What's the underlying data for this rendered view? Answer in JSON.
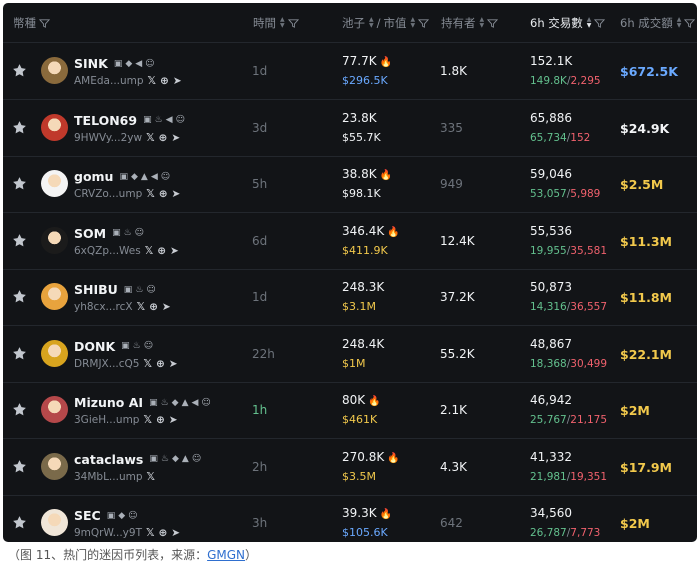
{
  "header": {
    "token": "幣種",
    "time": "時間",
    "pool": "池子",
    "mcap": "市值",
    "holders": "持有者",
    "txs": "6h 交易數",
    "volume": "6h 成交額"
  },
  "colors": {
    "blue": "#6aa9ff",
    "yellow": "#f2c94c",
    "white": "#f2f4f6",
    "green": "#63c08e",
    "red": "#f0616d",
    "dim": "#6d737b"
  },
  "rows": [
    {
      "name": "SINK",
      "addr": "AMEda...ump",
      "badges": [
        "page-icon",
        "pill-icon",
        "megaphone-icon",
        "clown-icon"
      ],
      "socials": [
        "x",
        "web",
        "telegram"
      ],
      "time": "1d",
      "time_color": "dim",
      "pool": "77.7K",
      "fire": true,
      "mcap": "$296.5K",
      "mcap_color": "blue",
      "holders": "1.8K",
      "holders_dim": false,
      "txs": "152.1K",
      "buys": "149.8K",
      "sells": "2,295",
      "vol": "$672.5K",
      "vol_color": "blue",
      "avatar": "#8a6a3c"
    },
    {
      "name": "TELON69",
      "addr": "9HWVy...2yw",
      "badges": [
        "page-icon",
        "fire-icon",
        "megaphone-icon",
        "clown-icon"
      ],
      "socials": [
        "x",
        "web",
        "telegram"
      ],
      "time": "3d",
      "time_color": "dim",
      "pool": "23.8K",
      "fire": false,
      "mcap": "$55.7K",
      "mcap_color": "white",
      "holders": "335",
      "holders_dim": true,
      "txs": "65,886",
      "buys": "65,734",
      "sells": "152",
      "vol": "$24.9K",
      "vol_color": "white",
      "avatar": "#c0392b"
    },
    {
      "name": "gomu",
      "addr": "CRVZo...ump",
      "badges": [
        "page-icon",
        "pill-icon",
        "crowd-icon",
        "megaphone-icon",
        "clown-icon"
      ],
      "socials": [
        "x",
        "web",
        "telegram"
      ],
      "time": "5h",
      "time_color": "dim",
      "pool": "38.8K",
      "fire": true,
      "mcap": "$98.1K",
      "mcap_color": "white",
      "holders": "949",
      "holders_dim": true,
      "txs": "59,046",
      "buys": "53,057",
      "sells": "5,989",
      "vol": "$2.5M",
      "vol_color": "yellow",
      "avatar": "#f4f4f4"
    },
    {
      "name": "SOM",
      "addr": "6xQZp...Wes",
      "badges": [
        "page-icon",
        "fire-icon",
        "clown-icon"
      ],
      "socials": [
        "x",
        "web",
        "telegram"
      ],
      "time": "6d",
      "time_color": "dim",
      "pool": "346.4K",
      "fire": true,
      "mcap": "$411.9K",
      "mcap_color": "yellow",
      "holders": "12.4K",
      "holders_dim": false,
      "txs": "55,536",
      "buys": "19,955",
      "sells": "35,581",
      "vol": "$11.3M",
      "vol_color": "yellow",
      "avatar": "#1b1b1b"
    },
    {
      "name": "SHIBU",
      "addr": "yh8cx...rcX",
      "badges": [
        "page-icon",
        "fire-icon",
        "clown-icon"
      ],
      "socials": [
        "x",
        "web",
        "telegram"
      ],
      "time": "1d",
      "time_color": "dim",
      "pool": "248.3K",
      "fire": false,
      "mcap": "$3.1M",
      "mcap_color": "yellow",
      "holders": "37.2K",
      "holders_dim": false,
      "txs": "50,873",
      "buys": "14,316",
      "sells": "36,557",
      "vol": "$11.8M",
      "vol_color": "yellow",
      "avatar": "#e8a33d"
    },
    {
      "name": "DONK",
      "addr": "DRMJX...cQ5",
      "badges": [
        "page-icon",
        "fire-icon",
        "clown-icon"
      ],
      "socials": [
        "x",
        "web",
        "telegram"
      ],
      "time": "22h",
      "time_color": "dim",
      "pool": "248.4K",
      "fire": false,
      "mcap": "$1M",
      "mcap_color": "yellow",
      "holders": "55.2K",
      "holders_dim": false,
      "txs": "48,867",
      "buys": "18,368",
      "sells": "30,499",
      "vol": "$22.1M",
      "vol_color": "yellow",
      "avatar": "#d8a41e"
    },
    {
      "name": "Mizuno AI",
      "addr": "3GieH...ump",
      "badges": [
        "page-icon",
        "fire-icon",
        "pill-icon",
        "crowd-icon",
        "megaphone-icon",
        "clown-icon"
      ],
      "socials": [
        "x",
        "web",
        "telegram"
      ],
      "time": "1h",
      "time_color": "green",
      "pool": "80K",
      "fire": true,
      "mcap": "$461K",
      "mcap_color": "yellow",
      "holders": "2.1K",
      "holders_dim": false,
      "txs": "46,942",
      "buys": "25,767",
      "sells": "21,175",
      "vol": "$2M",
      "vol_color": "yellow",
      "avatar": "#b5484a"
    },
    {
      "name": "cataclaws",
      "addr": "34MbL...ump",
      "badges": [
        "page-icon",
        "fire-icon",
        "pill-icon",
        "crowd-icon",
        "clown-icon"
      ],
      "socials": [
        "x"
      ],
      "time": "2h",
      "time_color": "dim",
      "pool": "270.8K",
      "fire": true,
      "mcap": "$3.5M",
      "mcap_color": "yellow",
      "holders": "4.3K",
      "holders_dim": false,
      "txs": "41,332",
      "buys": "21,981",
      "sells": "19,351",
      "vol": "$17.9M",
      "vol_color": "yellow",
      "avatar": "#7a6a4a"
    },
    {
      "name": "SEC",
      "addr": "9mQrW...y9T",
      "badges": [
        "page-icon",
        "pill-icon",
        "clown-icon"
      ],
      "socials": [
        "x",
        "web",
        "telegram"
      ],
      "time": "3h",
      "time_color": "dim",
      "pool": "39.3K",
      "fire": true,
      "mcap": "$105.6K",
      "mcap_color": "blue",
      "holders": "642",
      "holders_dim": true,
      "txs": "34,560",
      "buys": "26,787",
      "sells": "7,773",
      "vol": "$2M",
      "vol_color": "yellow",
      "avatar": "#f0e6d8"
    }
  ],
  "caption": {
    "prefix": "（图 11、热门的迷因币列表，来源：",
    "link": "GMGN",
    "suffix": "）"
  }
}
